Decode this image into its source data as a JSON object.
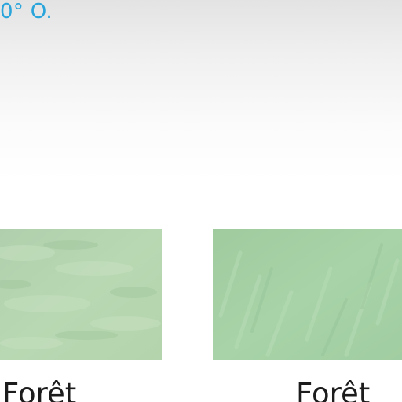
{
  "coordinate_text": "0° O.",
  "colors": {
    "link": "#2aa5dc",
    "forest_left": "#b5d5b0",
    "forest_right": "#a4cfa5"
  },
  "thumbnails": [
    {
      "label": "Forêt"
    },
    {
      "label": "Forêt"
    }
  ]
}
